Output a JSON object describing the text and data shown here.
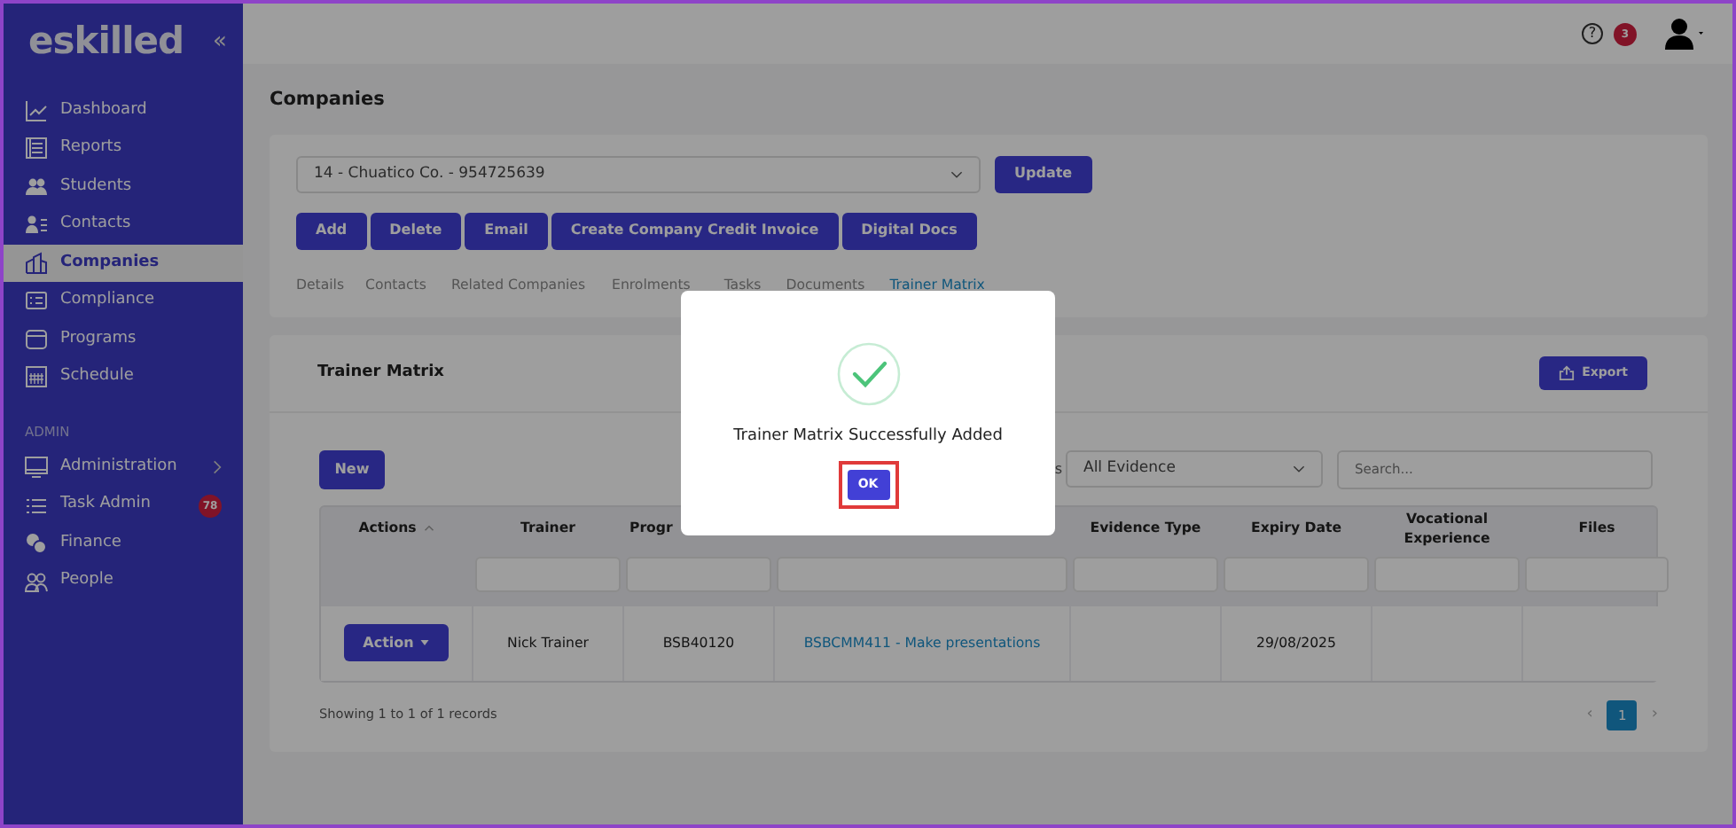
{
  "sidebar": {
    "logo": "eskilled",
    "collapse": "«",
    "items": [
      {
        "label": "Dashboard",
        "selected": false
      },
      {
        "label": "Reports",
        "selected": false
      },
      {
        "label": "Students",
        "selected": false
      },
      {
        "label": "Contacts",
        "selected": false
      },
      {
        "label": "Companies",
        "selected": true
      },
      {
        "label": "Compliance",
        "selected": false
      },
      {
        "label": "Programs",
        "selected": false
      },
      {
        "label": "Schedule",
        "selected": false
      }
    ],
    "section": "ADMIN",
    "admin_items": [
      {
        "label": "Administration",
        "expandable": true
      },
      {
        "label": "Task Admin",
        "badge": "78"
      },
      {
        "label": "Finance"
      },
      {
        "label": "People"
      }
    ]
  },
  "header": {
    "help": "?",
    "help_badge": "3"
  },
  "page_title": "Companies",
  "company_select": {
    "value": "14 - Chuatico Co. - 954725639"
  },
  "update_button": "Update",
  "actions": [
    "Add",
    "Delete",
    "Email",
    "Create Company Credit Invoice",
    "Digital Docs"
  ],
  "tabs": [
    {
      "label": "Details",
      "selected": false
    },
    {
      "label": "Contacts",
      "selected": false
    },
    {
      "label": "Related Companies",
      "selected": false
    },
    {
      "label": "Enrolments",
      "selected": false
    },
    {
      "label": "Tasks",
      "selected": false
    },
    {
      "label": "Documents",
      "selected": false
    },
    {
      "label": "Trainer Matrix",
      "selected": true
    }
  ],
  "matrix": {
    "title": "Trainer Matrix",
    "export_button": "Export",
    "new_button": "New",
    "filter_label": "s",
    "evidence_filter": {
      "value": "All Evidence"
    },
    "search": {
      "placeholder": "Search..."
    },
    "table": {
      "columns": [
        {
          "label": "Actions",
          "sortable": true
        },
        {
          "label": "Trainer"
        },
        {
          "label": "Progr"
        },
        {},
        {
          "label": "Evidence Type"
        },
        {
          "label": "Expiry Date"
        },
        {
          "label": "Vocational Experience"
        },
        {
          "label": "Files"
        }
      ],
      "rows": [
        [
          "Action",
          "Nick Trainer",
          "BSB40120",
          "BSBCMM411 - Make presentations",
          "",
          "29/08/2025",
          "",
          ""
        ]
      ]
    },
    "footer": "Showing 1 to 1 of 1 records",
    "previous": "‹",
    "next": "›",
    "pagination": [
      {
        "label": "1",
        "selected": true
      }
    ]
  },
  "dialog": {
    "message": "Trainer Matrix Successfully Added",
    "ok_button": "OK",
    "ok_focused": true
  }
}
